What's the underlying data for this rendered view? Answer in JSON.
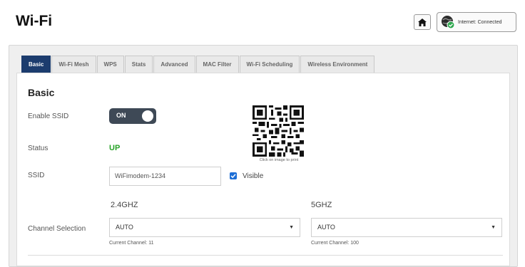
{
  "header": {
    "title": "Wi-Fi",
    "internet_status": "Internet: Connected"
  },
  "tabs": [
    {
      "label": "Basic",
      "active": true
    },
    {
      "label": "Wi-Fi Mesh",
      "active": false
    },
    {
      "label": "WPS",
      "active": false
    },
    {
      "label": "Stats",
      "active": false
    },
    {
      "label": "Advanced",
      "active": false
    },
    {
      "label": "MAC Filter",
      "active": false
    },
    {
      "label": "Wi-Fi Scheduling",
      "active": false
    },
    {
      "label": "Wireless Environment",
      "active": false
    }
  ],
  "basic": {
    "section_title": "Basic",
    "enable_ssid_label": "Enable SSID",
    "toggle_state": "ON",
    "status_label": "Status",
    "status_value": "UP",
    "ssid_label": "SSID",
    "ssid_value": "WiFimodem-1234",
    "visible_label": "Visible",
    "visible_checked": true,
    "qr_caption": "Click on image to print",
    "channel_selection_label": "Channel Selection",
    "band_24_label": "2.4GHZ",
    "band_24_value": "AUTO",
    "band_24_current": "Current Channel: 11",
    "band_5_label": "5GHZ",
    "band_5_value": "AUTO",
    "band_5_current": "Current Channel: 100"
  },
  "colors": {
    "tab_active": "#1c3c6e",
    "status_up": "#27a327",
    "toggle_bg": "#3e4956",
    "checkbox": "#1f6fd6"
  }
}
